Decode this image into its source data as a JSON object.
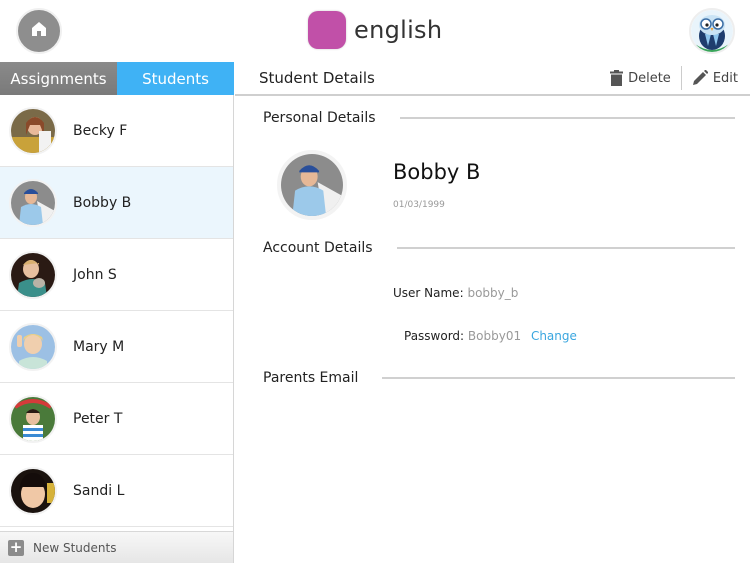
{
  "topbar": {
    "home_icon": "home-icon",
    "subject": {
      "label": "english",
      "color": "#c150a8"
    },
    "profile_icon": "owl-avatar-icon"
  },
  "tabs": [
    {
      "label": "Assignments",
      "active": false
    },
    {
      "label": "Students",
      "active": true,
      "color": "#3fb2f5"
    }
  ],
  "students": [
    {
      "name": "Becky F",
      "selected": false
    },
    {
      "name": "Bobby B",
      "selected": true
    },
    {
      "name": "John S",
      "selected": false
    },
    {
      "name": "Mary M",
      "selected": false
    },
    {
      "name": "Peter T",
      "selected": false
    },
    {
      "name": "Sandi L",
      "selected": false
    }
  ],
  "sidebar_footer": {
    "label": "New Students",
    "icon": "plus-icon"
  },
  "detail_header": {
    "title": "Student Details",
    "delete_label": "Delete",
    "edit_label": "Edit"
  },
  "personal": {
    "section_title": "Personal Details",
    "name": "Bobby B",
    "dob": "01/03/1999"
  },
  "account": {
    "section_title": "Account Details",
    "username_label": "User Name:",
    "username_value": "bobby_b",
    "password_label": "Password:",
    "password_value": "Bobby01",
    "change_label": "Change",
    "link_color": "#3aa6df"
  },
  "parents": {
    "section_title": "Parents Email"
  }
}
